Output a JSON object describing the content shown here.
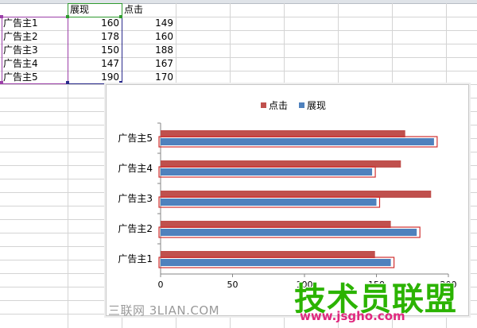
{
  "sheet": {
    "header": {
      "col_b": "展现",
      "col_c": "点击"
    },
    "rows": [
      {
        "name": "广告主1",
        "show": "160",
        "click": "149"
      },
      {
        "name": "广告主2",
        "show": "178",
        "click": "160"
      },
      {
        "name": "广告主3",
        "show": "150",
        "click": "188"
      },
      {
        "name": "广告主4",
        "show": "147",
        "click": "167"
      },
      {
        "name": "广告主5",
        "show": "190",
        "click": "170"
      }
    ]
  },
  "colors": {
    "click": "#c0504d",
    "show": "#4f81bd",
    "highlight_border": "#d03030"
  },
  "chart_data": {
    "type": "bar",
    "orientation": "horizontal",
    "categories": [
      "广告主1",
      "广告主2",
      "广告主3",
      "广告主4",
      "广告主5"
    ],
    "series": [
      {
        "name": "点击",
        "values": [
          149,
          160,
          188,
          167,
          170
        ]
      },
      {
        "name": "展现",
        "values": [
          160,
          178,
          150,
          147,
          190
        ]
      }
    ],
    "xlim": [
      0,
      200
    ],
    "x_ticks": [
      "0",
      "50",
      "100",
      "150",
      "200"
    ],
    "legend_position": "top",
    "grid": false
  },
  "watermarks": {
    "left": "三联网 3LIAN.COM",
    "big": "技术员联盟",
    "url": "www.jsgho.com"
  }
}
